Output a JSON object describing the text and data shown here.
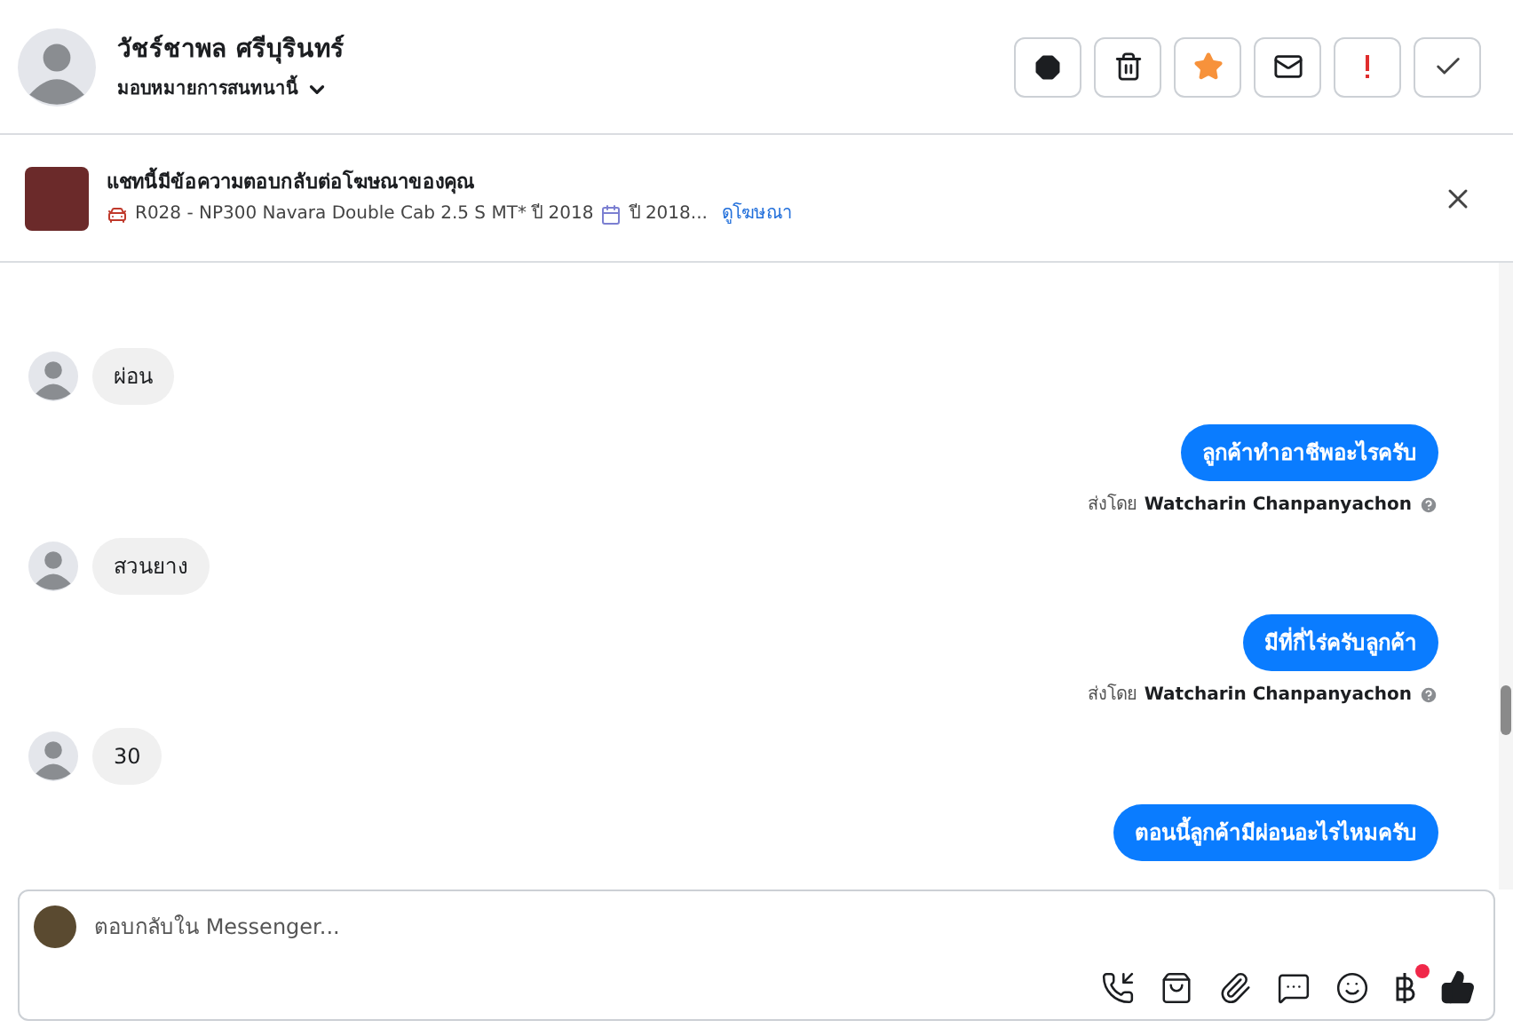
{
  "header": {
    "name": "วัชร์ชาพล ศรีบุรินทร์",
    "assign": "มอบหมายการสนทนานี้",
    "actions": [
      {
        "kind": "spam"
      },
      {
        "kind": "delete"
      },
      {
        "kind": "star"
      },
      {
        "kind": "unread"
      },
      {
        "kind": "important"
      },
      {
        "kind": "done"
      }
    ]
  },
  "ad_banner": {
    "title": "แชทนี้มีข้อความตอบกลับต่อโฆษณาของคุณ",
    "details": "R028 - NP300 Navara Double Cab 2.5 S MT* ปี 2018",
    "details_more": "ปี 2018...",
    "link": "ดูโฆษณา"
  },
  "messages": [
    {
      "kind": "incoming",
      "text": "ผ่อน"
    },
    {
      "kind": "outgoing",
      "text": "ลูกค้าทำอาชีพอะไรครับ",
      "sent_by_label": "ส่งโดย",
      "sender": "Watcharin Chanpanyachon"
    },
    {
      "kind": "incoming",
      "text": "สวนยาง"
    },
    {
      "kind": "outgoing",
      "text": "มีที่กี่ไร่ครับลูกค้า",
      "sent_by_label": "ส่งโดย",
      "sender": "Watcharin Chanpanyachon"
    },
    {
      "kind": "incoming",
      "text": "30"
    },
    {
      "kind": "outgoing",
      "text": "ตอนนี้ลูกค้ามีผ่อนอะไรไหมครับ"
    }
  ],
  "composer": {
    "placeholder": "ตอบกลับใน Messenger...",
    "tools": [
      {
        "kind": "call",
        "badge": false
      },
      {
        "kind": "shop",
        "badge": false
      },
      {
        "kind": "attach",
        "badge": false
      },
      {
        "kind": "replies",
        "badge": false
      },
      {
        "kind": "emoji",
        "badge": false
      },
      {
        "kind": "payment",
        "badge": true
      },
      {
        "kind": "like",
        "badge": false
      }
    ]
  }
}
